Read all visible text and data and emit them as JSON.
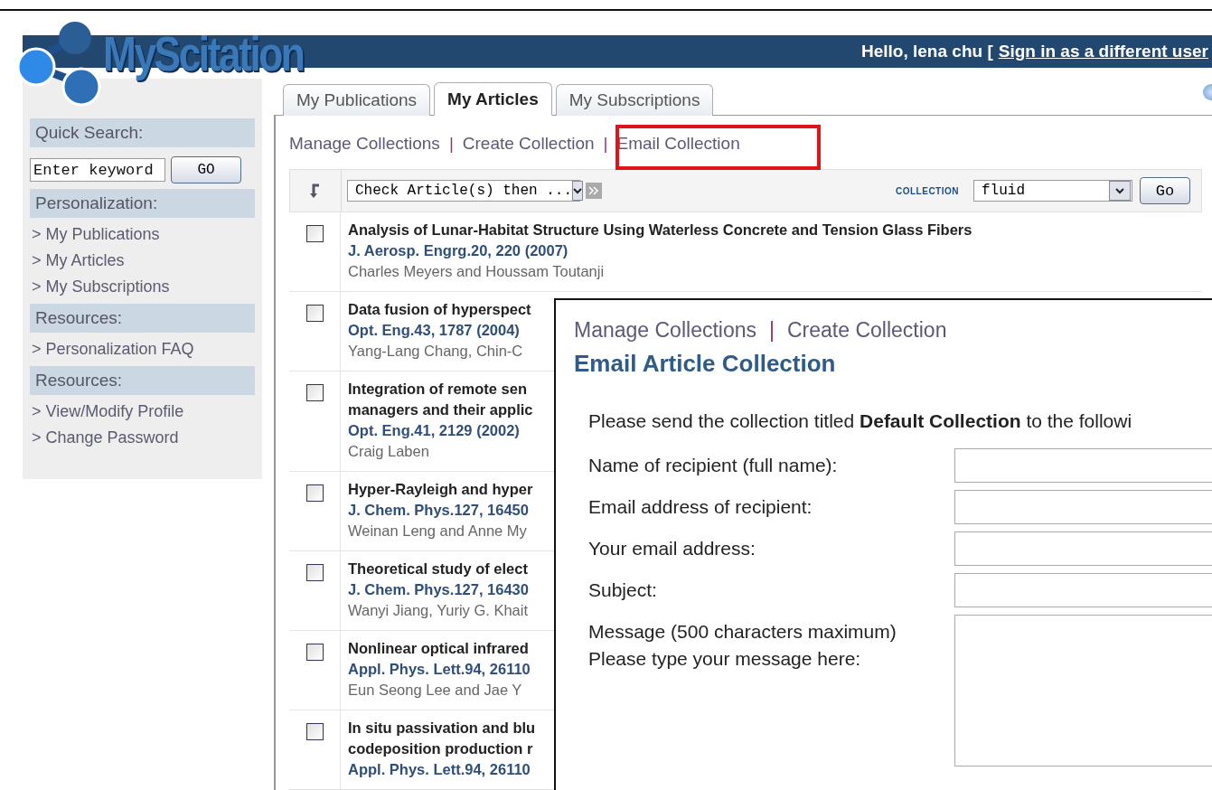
{
  "header": {
    "logo": "MyScitation",
    "greeting": "Hello, lena chu [",
    "sign_in_link": "Sign in as a different user"
  },
  "sidebar": {
    "sections": [
      {
        "heading": "Quick Search:",
        "kind": "search",
        "placeholder": "Enter keyword",
        "button": "GO"
      },
      {
        "heading": "Personalization:",
        "kind": "links",
        "links": [
          "> My Publications",
          "> My Articles",
          "> My Subscriptions"
        ]
      },
      {
        "heading": "Resources:",
        "kind": "links",
        "links": [
          "> Personalization FAQ"
        ]
      },
      {
        "heading": "Resources:",
        "kind": "links",
        "links": [
          "> View/Modify Profile",
          "> Change Password"
        ]
      }
    ]
  },
  "tabs": [
    {
      "label": "My Publications",
      "selected": false
    },
    {
      "label": "My Articles",
      "selected": true
    },
    {
      "label": "My Subscriptions",
      "selected": false
    }
  ],
  "collection_links": [
    {
      "kind": "link",
      "text": "Manage Collections"
    },
    {
      "kind": "separator",
      "text": "|"
    },
    {
      "kind": "link",
      "text": "Create Collection"
    },
    {
      "kind": "separator",
      "text": "|"
    },
    {
      "kind": "link",
      "text": "Email Collection"
    }
  ],
  "toolbar": {
    "action_select": "Check Article(s) then ...",
    "collection_label": "COLLECTION",
    "collection_select": "fluid",
    "go_button": "Go"
  },
  "articles": [
    {
      "title": [
        "Analysis of Lunar-Habitat Structure Using Waterless Concrete and Tension Glass Fibers"
      ],
      "journal": "J. Aerosp. Engrg.20, 220 (2007)",
      "authors": "Charles Meyers and Houssam Toutanji",
      "checked": false
    },
    {
      "title": [
        "Data fusion of hyperspect"
      ],
      "journal": "Opt. Eng.43, 1787 (2004)",
      "authors": "Yang-Lang Chang, Chin-C",
      "checked": false
    },
    {
      "title": [
        "Integration of remote sen",
        "managers and their applic"
      ],
      "journal": "Opt. Eng.41, 2129 (2002)",
      "authors": "Craig Laben",
      "checked": false
    },
    {
      "title": [
        "Hyper-Rayleigh and hyper"
      ],
      "journal": "J. Chem. Phys.127, 16450",
      "authors": "Weinan Leng and Anne My",
      "checked": false
    },
    {
      "title": [
        "Theoretical study of elect"
      ],
      "journal": "J. Chem. Phys.127, 16430",
      "authors": "Wanyi Jiang, Yuriy G. Khait",
      "checked": false
    },
    {
      "title": [
        "Nonlinear optical infrared"
      ],
      "journal": "Appl. Phys. Lett.94, 26110",
      "authors": "Eun Seong Lee and Jae Y",
      "checked": false
    },
    {
      "title": [
        "In situ passivation and blu",
        "codeposition production r"
      ],
      "journal": "Appl. Phys. Lett.94, 26110",
      "checked": false
    }
  ],
  "email_panel": {
    "links": [
      {
        "kind": "link",
        "text": "Manage Collections"
      },
      {
        "kind": "separator",
        "text": "|"
      },
      {
        "kind": "link",
        "text": "Create Collection"
      }
    ],
    "heading": "Email Article Collection",
    "intro": "Please send the collection titled **Default Collection** to the followi",
    "fields": [
      {
        "kind": "input",
        "label": [
          "Name of recipient (full name):"
        ]
      },
      {
        "kind": "input",
        "label": [
          "Email address of recipient:"
        ]
      },
      {
        "kind": "input",
        "label": [
          "Your email address:"
        ]
      },
      {
        "kind": "input",
        "label": [
          "Subject:"
        ]
      },
      {
        "kind": "textarea",
        "label": [
          "Message (500 characters maximum)",
          "Please type your message here:"
        ]
      }
    ]
  }
}
